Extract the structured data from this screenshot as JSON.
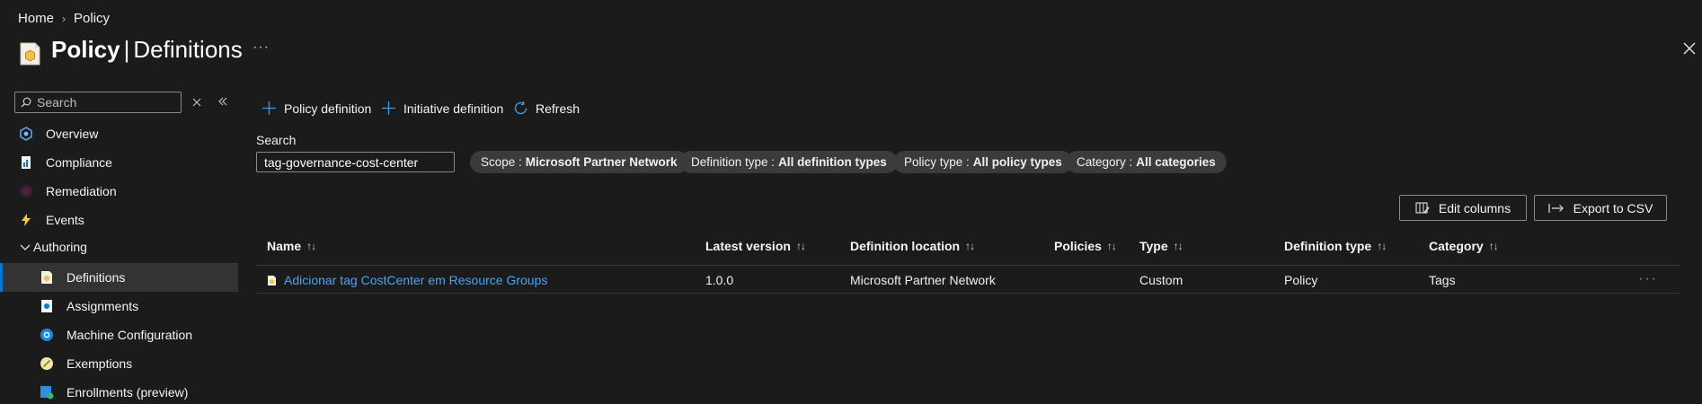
{
  "breadcrumb": {
    "home": "Home",
    "current": "Policy",
    "separator": "›"
  },
  "header": {
    "title_main": "Policy",
    "title_sep": "|",
    "title_sub": "Definitions",
    "more": "···"
  },
  "sidebar": {
    "search_placeholder": "Search",
    "items": [
      {
        "label": "Overview",
        "icon": "overview-icon"
      },
      {
        "label": "Compliance",
        "icon": "compliance-icon"
      },
      {
        "label": "Remediation",
        "icon": "remediation-icon"
      },
      {
        "label": "Events",
        "icon": "lightning-icon"
      },
      {
        "label": "Authoring",
        "icon": "chevron-down-icon"
      },
      {
        "label": "Definitions",
        "icon": "definitions-icon"
      },
      {
        "label": "Assignments",
        "icon": "assignments-icon"
      },
      {
        "label": "Machine Configuration",
        "icon": "machine-config-icon"
      },
      {
        "label": "Exemptions",
        "icon": "exemptions-icon"
      },
      {
        "label": "Enrollments (preview)",
        "icon": "enrollments-icon"
      }
    ]
  },
  "toolbar": {
    "policy_definition": "Policy definition",
    "initiative_definition": "Initiative definition",
    "refresh": "Refresh"
  },
  "filters": {
    "search_label": "Search",
    "search_value": "tag-governance-cost-center",
    "scope_label": "Scope :",
    "scope_value": "Microsoft Partner Network",
    "deftype_label": "Definition type :",
    "deftype_value": "All definition types",
    "policytype_label": "Policy type :",
    "policytype_value": "All policy types",
    "category_label": "Category :",
    "category_value": "All categories"
  },
  "actions": {
    "edit_columns": "Edit columns",
    "export_csv": "Export to CSV"
  },
  "table": {
    "sort_glyph": "↑↓",
    "columns": [
      "Name",
      "Latest version",
      "Definition location",
      "Policies",
      "Type",
      "Definition type",
      "Category"
    ],
    "rows": [
      {
        "name": "Adicionar tag CostCenter em Resource Groups",
        "version": "1.0.0",
        "location": "Microsoft Partner Network",
        "policies": "",
        "type": "Custom",
        "definition_type": "Policy",
        "category": "Tags",
        "more": "···"
      }
    ]
  },
  "colors": {
    "accent": "#0078d4",
    "link": "#4aa3f0",
    "background": "#1b1b1b"
  }
}
